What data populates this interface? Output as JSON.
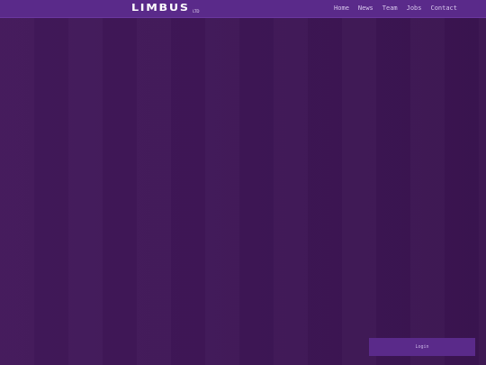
{
  "header": {
    "logo_text": "LIMBUS",
    "logo_suffix": "LTD",
    "nav": [
      {
        "label": "Home"
      },
      {
        "label": "News"
      },
      {
        "label": "Team"
      },
      {
        "label": "Jobs"
      },
      {
        "label": "Contact"
      }
    ]
  },
  "login": {
    "label": "Login"
  },
  "colors": {
    "background": "#3e1656",
    "header": "#5a2a8a",
    "accent": "#5a2a8a",
    "text": "#ffffff"
  }
}
